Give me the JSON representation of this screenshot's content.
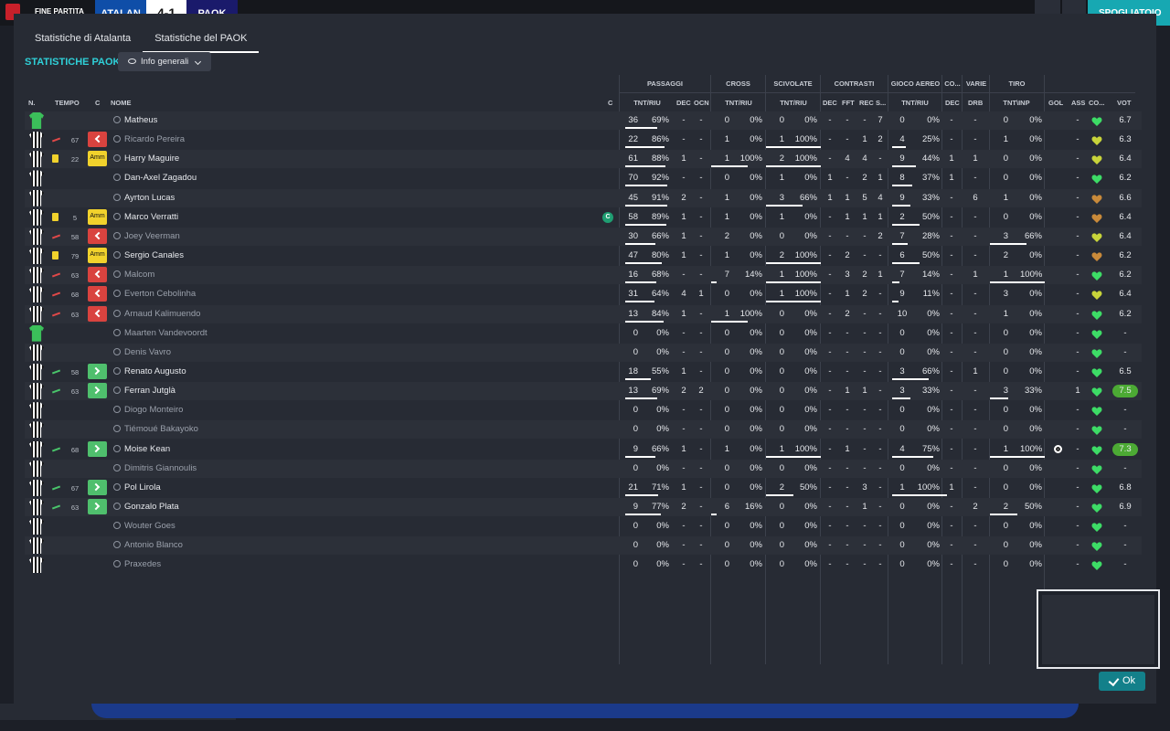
{
  "topbar": {
    "end_label": "FINE PARTITA",
    "team_home": "ATALAN",
    "score": "4-1",
    "team_away": "PAOK",
    "right_label": "SPOGLIATOIO"
  },
  "tabs": [
    {
      "label": "Statistiche di Atalanta"
    },
    {
      "label": "Statistiche del PAOK"
    }
  ],
  "heading": "STATISTICHE PAOK",
  "dropdown": {
    "label": "Info generali"
  },
  "groups": {
    "passaggi": "PASSAGGI",
    "cross": "CROSS",
    "scivolate": "SCIVOLATE",
    "contrasti": "CONTRASTI",
    "gioco_aereo": "GIOCO AEREO",
    "co": "CO...",
    "varie": "VARIE",
    "tiro": "TIRO"
  },
  "headers": {
    "n": "N.",
    "tempo": "TEMPO",
    "c": "C",
    "nome": "NOME",
    "cap": "C",
    "tnt_riu1": "TNT/RIU",
    "dec": "DEC",
    "ocn": "OCN",
    "tnt_riu2": "TNT/RIU",
    "tnt_riu3": "TNT/RIU",
    "dec2": "DEC",
    "fft": "FFT",
    "rec": "REC",
    "s": "S...",
    "tnt_riu4": "TNT/RIU",
    "dec3": "DEC",
    "drb": "DRB",
    "tnt_inp": "TNT\\INP",
    "gol": "GOL",
    "ass": "ASS",
    "co2": "CO...",
    "vot": "VOT"
  },
  "colors": {
    "accent": "#2fd0d8",
    "yellow_card": "#f1d22c",
    "sub_out": "#d9433f",
    "sub_in": "#4fbf6d",
    "morale_green": "#3ddc66",
    "morale_yellow": "#c8d43a",
    "morale_brown": "#c98a3a"
  },
  "players": [
    {
      "name": "Matheus",
      "gk": true,
      "pass": "36",
      "pass_pct": "69%",
      "pass_fill": 0.69,
      "dec": "-",
      "ocn": "-",
      "cross": "0",
      "cross_pct": "0%",
      "scv": "0",
      "scv_pct": "0%",
      "cdec": "-",
      "fft": "-",
      "rec": "-",
      "s": "7",
      "ae": "0",
      "ae_pct": "0%",
      "co": "-",
      "drb": "-",
      "tiro": "0",
      "tiro_pct": "0%",
      "gol": "",
      "ass": "-",
      "morale": "green",
      "vot": "6.7"
    },
    {
      "name": "Ricardo Pereira",
      "dim": true,
      "sub": "out",
      "minute": "67",
      "badge": "out",
      "pass": "22",
      "pass_pct": "86%",
      "pass_fill": 0.86,
      "dec": "-",
      "ocn": "-",
      "cross": "1",
      "cross_pct": "0%",
      "scv": "1",
      "scv_pct": "100%",
      "scv_fill": 1,
      "cdec": "-",
      "fft": "-",
      "rec": "1",
      "s": "2",
      "ae": "4",
      "ae_pct": "25%",
      "ae_fill": 0.25,
      "co": "-",
      "drb": "-",
      "tiro": "1",
      "tiro_pct": "0%",
      "gol": "",
      "ass": "-",
      "morale": "yellow",
      "vot": "6.3"
    },
    {
      "name": "Harry Maguire",
      "card": "yellow",
      "minute": "22",
      "badge": "amm",
      "pass": "61",
      "pass_pct": "88%",
      "pass_fill": 0.88,
      "dec": "1",
      "ocn": "-",
      "cross": "1",
      "cross_pct": "100%",
      "cross_fill": 1,
      "scv": "2",
      "scv_pct": "100%",
      "scv_fill": 1,
      "cdec": "-",
      "fft": "4",
      "rec": "4",
      "s": "-",
      "ae": "9",
      "ae_pct": "44%",
      "ae_fill": 0.44,
      "co": "1",
      "drb": "1",
      "tiro": "0",
      "tiro_pct": "0%",
      "gol": "",
      "ass": "-",
      "morale": "yellow",
      "vot": "6.4"
    },
    {
      "name": "Dan-Axel Zagadou",
      "pass": "70",
      "pass_pct": "92%",
      "pass_fill": 0.92,
      "dec": "-",
      "ocn": "-",
      "cross": "0",
      "cross_pct": "0%",
      "scv": "1",
      "scv_pct": "0%",
      "cdec": "1",
      "fft": "-",
      "rec": "2",
      "s": "1",
      "ae": "8",
      "ae_pct": "37%",
      "ae_fill": 0.37,
      "co": "1",
      "drb": "-",
      "tiro": "0",
      "tiro_pct": "0%",
      "gol": "",
      "ass": "-",
      "morale": "green",
      "vot": "6.2"
    },
    {
      "name": "Ayrton Lucas",
      "pass": "45",
      "pass_pct": "91%",
      "pass_fill": 0.91,
      "dec": "2",
      "ocn": "-",
      "cross": "1",
      "cross_pct": "0%",
      "scv": "3",
      "scv_pct": "66%",
      "scv_fill": 0.66,
      "cdec": "1",
      "fft": "1",
      "rec": "5",
      "s": "4",
      "ae": "9",
      "ae_pct": "33%",
      "ae_fill": 0.33,
      "co": "-",
      "drb": "6",
      "tiro": "1",
      "tiro_pct": "0%",
      "gol": "",
      "ass": "-",
      "morale": "brown",
      "vot": "6.6"
    },
    {
      "name": "Marco Verratti",
      "card": "yellow",
      "minute": "5",
      "badge": "amm",
      "captain": true,
      "pass": "58",
      "pass_pct": "89%",
      "pass_fill": 0.89,
      "dec": "1",
      "ocn": "-",
      "cross": "1",
      "cross_pct": "0%",
      "scv": "1",
      "scv_pct": "0%",
      "cdec": "-",
      "fft": "1",
      "rec": "1",
      "s": "1",
      "ae": "2",
      "ae_pct": "50%",
      "ae_fill": 0.5,
      "co": "-",
      "drb": "-",
      "tiro": "0",
      "tiro_pct": "0%",
      "gol": "",
      "ass": "-",
      "morale": "brown",
      "vot": "6.4"
    },
    {
      "name": "Joey Veerman",
      "dim": true,
      "sub": "out",
      "minute": "58",
      "badge": "out",
      "pass": "30",
      "pass_pct": "66%",
      "pass_fill": 0.66,
      "dec": "1",
      "ocn": "-",
      "cross": "2",
      "cross_pct": "0%",
      "scv": "0",
      "scv_pct": "0%",
      "cdec": "-",
      "fft": "-",
      "rec": "-",
      "s": "2",
      "ae": "7",
      "ae_pct": "28%",
      "ae_fill": 0.28,
      "co": "-",
      "drb": "-",
      "tiro": "3",
      "tiro_pct": "66%",
      "tiro_fill": 0.66,
      "gol": "",
      "ass": "-",
      "morale": "yellow",
      "vot": "6.4"
    },
    {
      "name": "Sergio Canales",
      "card": "yellow",
      "minute": "79",
      "badge": "amm",
      "pass": "47",
      "pass_pct": "80%",
      "pass_fill": 0.8,
      "dec": "1",
      "ocn": "-",
      "cross": "1",
      "cross_pct": "0%",
      "scv": "2",
      "scv_pct": "100%",
      "scv_fill": 1,
      "cdec": "-",
      "fft": "2",
      "rec": "-",
      "s": "-",
      "ae": "6",
      "ae_pct": "50%",
      "ae_fill": 0.5,
      "co": "-",
      "drb": "-",
      "tiro": "2",
      "tiro_pct": "0%",
      "gol": "",
      "ass": "-",
      "morale": "brown",
      "vot": "6.2"
    },
    {
      "name": "Malcom",
      "dim": true,
      "sub": "out",
      "minute": "63",
      "badge": "out",
      "pass": "16",
      "pass_pct": "68%",
      "pass_fill": 0.68,
      "dec": "-",
      "ocn": "-",
      "cross": "7",
      "cross_pct": "14%",
      "cross_fill": 0.14,
      "scv": "1",
      "scv_pct": "100%",
      "scv_fill": 1,
      "cdec": "-",
      "fft": "3",
      "rec": "2",
      "s": "1",
      "ae": "7",
      "ae_pct": "14%",
      "ae_fill": 0.14,
      "co": "-",
      "drb": "1",
      "tiro": "1",
      "tiro_pct": "100%",
      "tiro_fill": 1,
      "gol": "",
      "ass": "-",
      "morale": "green",
      "vot": "6.2"
    },
    {
      "name": "Everton Cebolinha",
      "dim": true,
      "sub": "out",
      "minute": "68",
      "badge": "out",
      "pass": "31",
      "pass_pct": "64%",
      "pass_fill": 0.64,
      "dec": "4",
      "ocn": "1",
      "cross": "0",
      "cross_pct": "0%",
      "scv": "1",
      "scv_pct": "100%",
      "scv_fill": 1,
      "cdec": "-",
      "fft": "1",
      "rec": "2",
      "s": "-",
      "ae": "9",
      "ae_pct": "11%",
      "ae_fill": 0.11,
      "co": "-",
      "drb": "-",
      "tiro": "3",
      "tiro_pct": "0%",
      "gol": "",
      "ass": "-",
      "morale": "yellow",
      "vot": "6.4"
    },
    {
      "name": "Arnaud Kalimuendo",
      "dim": true,
      "sub": "out",
      "minute": "63",
      "badge": "out",
      "pass": "13",
      "pass_pct": "84%",
      "pass_fill": 0.84,
      "dec": "1",
      "ocn": "-",
      "cross": "1",
      "cross_pct": "100%",
      "cross_fill": 1,
      "scv": "0",
      "scv_pct": "0%",
      "cdec": "-",
      "fft": "2",
      "rec": "-",
      "s": "-",
      "ae": "10",
      "ae_pct": "0%",
      "co": "-",
      "drb": "-",
      "tiro": "1",
      "tiro_pct": "0%",
      "gol": "",
      "ass": "-",
      "morale": "green",
      "vot": "6.2"
    },
    {
      "name": "Maarten Vandevoordt",
      "gk": true,
      "dim": true,
      "pass": "0",
      "pass_pct": "0%",
      "dec": "-",
      "ocn": "-",
      "cross": "0",
      "cross_pct": "0%",
      "scv": "0",
      "scv_pct": "0%",
      "cdec": "-",
      "fft": "-",
      "rec": "-",
      "s": "-",
      "ae": "0",
      "ae_pct": "0%",
      "co": "-",
      "drb": "-",
      "tiro": "0",
      "tiro_pct": "0%",
      "gol": "",
      "ass": "-",
      "morale": "green",
      "vot": "-"
    },
    {
      "name": "Denis Vavro",
      "dim": true,
      "pass": "0",
      "pass_pct": "0%",
      "dec": "-",
      "ocn": "-",
      "cross": "0",
      "cross_pct": "0%",
      "scv": "0",
      "scv_pct": "0%",
      "cdec": "-",
      "fft": "-",
      "rec": "-",
      "s": "-",
      "ae": "0",
      "ae_pct": "0%",
      "co": "-",
      "drb": "-",
      "tiro": "0",
      "tiro_pct": "0%",
      "gol": "",
      "ass": "-",
      "morale": "green",
      "vot": "-"
    },
    {
      "name": "Renato Augusto",
      "sub": "in",
      "minute": "58",
      "badge": "in",
      "pass": "18",
      "pass_pct": "55%",
      "pass_fill": 0.55,
      "dec": "1",
      "ocn": "-",
      "cross": "0",
      "cross_pct": "0%",
      "scv": "0",
      "scv_pct": "0%",
      "cdec": "-",
      "fft": "-",
      "rec": "-",
      "s": "-",
      "ae": "3",
      "ae_pct": "66%",
      "ae_fill": 0.66,
      "co": "-",
      "drb": "1",
      "tiro": "0",
      "tiro_pct": "0%",
      "gol": "",
      "ass": "-",
      "morale": "green",
      "vot": "6.5"
    },
    {
      "name": "Ferran Jutglà",
      "sub": "in",
      "minute": "63",
      "badge": "in",
      "pass": "13",
      "pass_pct": "69%",
      "pass_fill": 0.69,
      "dec": "2",
      "ocn": "2",
      "cross": "0",
      "cross_pct": "0%",
      "scv": "0",
      "scv_pct": "0%",
      "cdec": "-",
      "fft": "1",
      "rec": "1",
      "s": "-",
      "ae": "3",
      "ae_pct": "33%",
      "ae_fill": 0.33,
      "co": "-",
      "drb": "-",
      "tiro": "3",
      "tiro_pct": "33%",
      "tiro_fill": 0.33,
      "gol": "",
      "ass": "1",
      "morale": "green",
      "vot": "7.5",
      "vot_hi": true
    },
    {
      "name": "Diogo Monteiro",
      "dim": true,
      "pass": "0",
      "pass_pct": "0%",
      "dec": "-",
      "ocn": "-",
      "cross": "0",
      "cross_pct": "0%",
      "scv": "0",
      "scv_pct": "0%",
      "cdec": "-",
      "fft": "-",
      "rec": "-",
      "s": "-",
      "ae": "0",
      "ae_pct": "0%",
      "co": "-",
      "drb": "-",
      "tiro": "0",
      "tiro_pct": "0%",
      "gol": "",
      "ass": "-",
      "morale": "green",
      "vot": "-"
    },
    {
      "name": "Tiémoué Bakayoko",
      "dim": true,
      "pass": "0",
      "pass_pct": "0%",
      "dec": "-",
      "ocn": "-",
      "cross": "0",
      "cross_pct": "0%",
      "scv": "0",
      "scv_pct": "0%",
      "cdec": "-",
      "fft": "-",
      "rec": "-",
      "s": "-",
      "ae": "0",
      "ae_pct": "0%",
      "co": "-",
      "drb": "-",
      "tiro": "0",
      "tiro_pct": "0%",
      "gol": "",
      "ass": "-",
      "morale": "green",
      "vot": "-"
    },
    {
      "name": "Moise Kean",
      "sub": "in",
      "minute": "68",
      "badge": "in",
      "pass": "9",
      "pass_pct": "66%",
      "pass_fill": 0.66,
      "dec": "1",
      "ocn": "-",
      "cross": "1",
      "cross_pct": "0%",
      "scv": "1",
      "scv_pct": "100%",
      "scv_fill": 1,
      "cdec": "-",
      "fft": "1",
      "rec": "-",
      "s": "-",
      "ae": "4",
      "ae_pct": "75%",
      "ae_fill": 0.75,
      "co": "-",
      "drb": "-",
      "tiro": "1",
      "tiro_pct": "100%",
      "tiro_fill": 1,
      "goal": true,
      "gol": "",
      "ass": "-",
      "morale": "green",
      "vot": "7.3",
      "vot_hi": true
    },
    {
      "name": "Dimitris Giannoulis",
      "dim": true,
      "pass": "0",
      "pass_pct": "0%",
      "dec": "-",
      "ocn": "-",
      "cross": "0",
      "cross_pct": "0%",
      "scv": "0",
      "scv_pct": "0%",
      "cdec": "-",
      "fft": "-",
      "rec": "-",
      "s": "-",
      "ae": "0",
      "ae_pct": "0%",
      "co": "-",
      "drb": "-",
      "tiro": "0",
      "tiro_pct": "0%",
      "gol": "",
      "ass": "-",
      "morale": "green",
      "vot": "-"
    },
    {
      "name": "Pol Lirola",
      "sub": "in",
      "minute": "67",
      "badge": "in",
      "pass": "21",
      "pass_pct": "71%",
      "pass_fill": 0.71,
      "dec": "1",
      "ocn": "-",
      "cross": "0",
      "cross_pct": "0%",
      "scv": "2",
      "scv_pct": "50%",
      "scv_fill": 0.5,
      "cdec": "-",
      "fft": "-",
      "rec": "3",
      "s": "-",
      "ae": "1",
      "ae_pct": "100%",
      "ae_fill": 1,
      "co": "1",
      "drb": "-",
      "tiro": "0",
      "tiro_pct": "0%",
      "gol": "",
      "ass": "-",
      "morale": "green",
      "vot": "6.8"
    },
    {
      "name": "Gonzalo Plata",
      "sub": "in",
      "minute": "63",
      "badge": "in",
      "pass": "9",
      "pass_pct": "77%",
      "pass_fill": 0.77,
      "dec": "2",
      "ocn": "-",
      "cross": "6",
      "cross_pct": "16%",
      "cross_fill": 0.16,
      "scv": "0",
      "scv_pct": "0%",
      "cdec": "-",
      "fft": "-",
      "rec": "1",
      "s": "-",
      "ae": "0",
      "ae_pct": "0%",
      "co": "-",
      "drb": "2",
      "tiro": "2",
      "tiro_pct": "50%",
      "tiro_fill": 0.5,
      "gol": "",
      "ass": "-",
      "morale": "green",
      "vot": "6.9"
    },
    {
      "name": "Wouter Goes",
      "dim": true,
      "pass": "0",
      "pass_pct": "0%",
      "dec": "-",
      "ocn": "-",
      "cross": "0",
      "cross_pct": "0%",
      "scv": "0",
      "scv_pct": "0%",
      "cdec": "-",
      "fft": "-",
      "rec": "-",
      "s": "-",
      "ae": "0",
      "ae_pct": "0%",
      "co": "-",
      "drb": "-",
      "tiro": "0",
      "tiro_pct": "0%",
      "gol": "",
      "ass": "-",
      "morale": "green",
      "vot": "-"
    },
    {
      "name": "Antonio Blanco",
      "dim": true,
      "pass": "0",
      "pass_pct": "0%",
      "dec": "-",
      "ocn": "-",
      "cross": "0",
      "cross_pct": "0%",
      "scv": "0",
      "scv_pct": "0%",
      "cdec": "-",
      "fft": "-",
      "rec": "-",
      "s": "-",
      "ae": "0",
      "ae_pct": "0%",
      "co": "-",
      "drb": "-",
      "tiro": "0",
      "tiro_pct": "0%",
      "gol": "",
      "ass": "-",
      "morale": "green",
      "vot": "-"
    },
    {
      "name": "Praxedes",
      "dim": true,
      "pass": "0",
      "pass_pct": "0%",
      "dec": "-",
      "ocn": "-",
      "cross": "0",
      "cross_pct": "0%",
      "scv": "0",
      "scv_pct": "0%",
      "cdec": "-",
      "fft": "-",
      "rec": "-",
      "s": "-",
      "ae": "0",
      "ae_pct": "0%",
      "co": "-",
      "drb": "-",
      "tiro": "0",
      "tiro_pct": "0%",
      "gol": "",
      "ass": "-",
      "morale": "green",
      "vot": "-"
    }
  ],
  "badges": {
    "amm": "Amm"
  },
  "captain_label": "C",
  "ok_button": {
    "label": "Ok"
  }
}
